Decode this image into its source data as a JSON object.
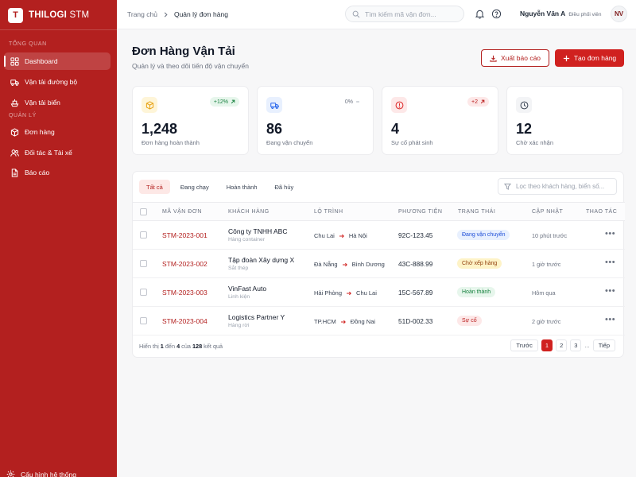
{
  "brand": {
    "logo_letter": "T",
    "name_bold": "THILOGI",
    "name_thin": " STM"
  },
  "sidebar": {
    "section_overview": "TỔNG QUAN",
    "section_manage": "QUẢN LÝ",
    "items": [
      {
        "label": "Dashboard",
        "icon": "grid-icon"
      },
      {
        "label": "Vận tải đường bộ",
        "icon": "truck-icon"
      },
      {
        "label": "Vận tải biển",
        "icon": "ship-icon"
      },
      {
        "label": "Đơn hàng",
        "icon": "box-icon"
      },
      {
        "label": "Đối tác & Tài xế",
        "icon": "users-icon"
      },
      {
        "label": "Báo cáo",
        "icon": "file-icon"
      }
    ],
    "footer": "Cấu hình hệ thống"
  },
  "topbar": {
    "breadcrumb_home": "Trang chủ",
    "breadcrumb_current": "Quản lý đơn hàng",
    "search_placeholder": "Tìm kiếm mã vận đơn...",
    "user_name": "Nguyễn Văn A",
    "user_role": "Điều phối viên",
    "avatar_initials": "NV"
  },
  "header": {
    "title": "Đơn Hàng Vận Tải",
    "subtitle": "Quản lý và theo dõi tiến độ vận chuyển",
    "export_label": "Xuất báo cáo",
    "create_label": "Tạo đơn hàng"
  },
  "stats": [
    {
      "value": "1,248",
      "label": "Đơn hàng hoàn thành",
      "badge": "+12%",
      "icon": "package-icon",
      "color": "#e8a317"
    },
    {
      "value": "86",
      "label": "Đang vận chuyển",
      "badge": "0%",
      "icon": "truck-icon",
      "color": "#2563eb"
    },
    {
      "value": "4",
      "label": "Sự cố phát sinh",
      "badge": "+2",
      "icon": "alert-icon",
      "color": "#dc2626"
    },
    {
      "value": "12",
      "label": "Chờ xác nhận",
      "badge": "",
      "icon": "clock-icon",
      "color": "#374151"
    }
  ],
  "filters": {
    "tabs": [
      "Tất cả",
      "Đang chạy",
      "Hoàn thành",
      "Đã hủy"
    ],
    "active": 0,
    "search_placeholder": "Lọc theo khách hàng, biển số..."
  },
  "table": {
    "columns": [
      "MÃ VẬN ĐƠN",
      "KHÁCH HÀNG",
      "LỘ TRÌNH",
      "PHƯƠNG TIỆN",
      "TRẠNG THÁI",
      "CẬP NHẬT",
      "THAO TÁC"
    ],
    "rows": [
      {
        "code": "STM-2023-001",
        "customer": "Công ty TNHH ABC",
        "cargo": "Hàng container",
        "from": "Chu Lai",
        "to": "Hà Nội",
        "vehicle": "92C-123.45",
        "status": "Đang vận chuyển",
        "status_bg": "#e8f0fe",
        "status_fg": "#1d4ed8",
        "updated": "10 phút trước"
      },
      {
        "code": "STM-2023-002",
        "customer": "Tập đoàn Xây dựng X",
        "cargo": "Sắt thép",
        "from": "Đà Nẵng",
        "to": "Bình Dương",
        "vehicle": "43C-888.99",
        "status": "Chờ xếp hàng",
        "status_bg": "#fef3c7",
        "status_fg": "#92400e",
        "updated": "1 giờ trước"
      },
      {
        "code": "STM-2023-003",
        "customer": "VinFast Auto",
        "cargo": "Linh kiện",
        "from": "Hải Phòng",
        "to": "Chu Lai",
        "vehicle": "15C-567.89",
        "status": "Hoàn thành",
        "status_bg": "#e7f6ec",
        "status_fg": "#15803d",
        "updated": "Hôm qua"
      },
      {
        "code": "STM-2023-004",
        "customer": "Logistics Partner Y",
        "cargo": "Hàng rời",
        "from": "TP.HCM",
        "to": "Đồng Nai",
        "vehicle": "51D-002.33",
        "status": "Sự cố",
        "status_bg": "#fde8e8",
        "status_fg": "#b91c1c",
        "updated": "2 giờ trước"
      }
    ]
  },
  "pagination": {
    "text_1": "Hiển thị ",
    "start": "1",
    "text_2": " đến ",
    "end": "4",
    "text_3": " của ",
    "total": "128",
    "text_4": " kết quả",
    "prev": "Trước",
    "next": "Tiếp",
    "pages": [
      "1",
      "2",
      "3"
    ],
    "ellipsis": "...",
    "active_page": "1"
  },
  "colors": {
    "brand": "#b3201f",
    "accent": "#d0211f"
  }
}
